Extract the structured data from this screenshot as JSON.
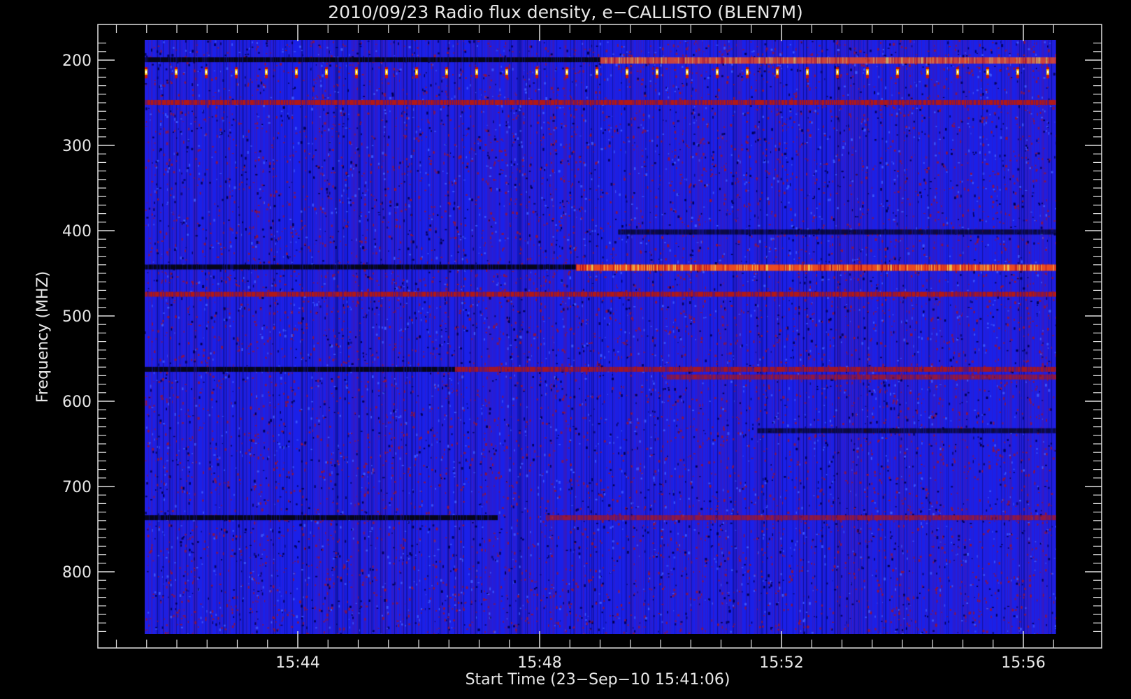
{
  "chart_data": {
    "type": "heatmap",
    "title": "2010/09/23  Radio flux density, e−CALLISTO (BLEN7M)",
    "xlabel": "Start Time (23−Sep−10 15:41:06)",
    "ylabel": "Frequency (MHZ)",
    "x_range_minutes": [
      0,
      15.9
    ],
    "x_range": [
      "15:41:06",
      "15:57:00"
    ],
    "y_range_mhz": [
      178,
      878
    ],
    "y_inverted": true,
    "x_ticks": [
      {
        "label": "15:44",
        "minutes": 2.9
      },
      {
        "label": "15:48",
        "minutes": 6.9
      },
      {
        "label": "15:52",
        "minutes": 10.9
      },
      {
        "label": "15:56",
        "minutes": 14.9
      }
    ],
    "y_ticks": [
      200,
      300,
      400,
      500,
      600,
      700,
      800
    ],
    "colormap": [
      "#000000",
      "#0000ff",
      "#7a1a8a",
      "#c01010",
      "#ff4000",
      "#ffc000",
      "#ffffff"
    ],
    "background_color": "#1a20e8",
    "bands": [
      {
        "freq_mhz": 200,
        "minute_start": 0.0,
        "minute_end": 7.9,
        "level": "low"
      },
      {
        "freq_mhz": 200,
        "minute_start": 7.9,
        "minute_end": 15.9,
        "level": "high"
      },
      {
        "freq_mhz": 214,
        "minute_start": 0.0,
        "minute_end": 15.9,
        "level": "periodic-bursts"
      },
      {
        "freq_mhz": 250,
        "minute_start": 0.0,
        "minute_end": 15.9,
        "level": "medium"
      },
      {
        "freq_mhz": 402,
        "minute_start": 8.2,
        "minute_end": 15.9,
        "level": "low"
      },
      {
        "freq_mhz": 443,
        "minute_start": 0.0,
        "minute_end": 7.5,
        "level": "low"
      },
      {
        "freq_mhz": 443,
        "minute_start": 7.5,
        "minute_end": 15.9,
        "level": "high"
      },
      {
        "freq_mhz": 475,
        "minute_start": 0.0,
        "minute_end": 15.9,
        "level": "medium"
      },
      {
        "freq_mhz": 563,
        "minute_start": 0.0,
        "minute_end": 5.5,
        "level": "low"
      },
      {
        "freq_mhz": 563,
        "minute_start": 5.5,
        "minute_end": 15.9,
        "level": "medium"
      },
      {
        "freq_mhz": 572,
        "minute_start": 9.0,
        "minute_end": 15.9,
        "level": "medium"
      },
      {
        "freq_mhz": 635,
        "minute_start": 10.5,
        "minute_end": 15.9,
        "level": "low"
      },
      {
        "freq_mhz": 737,
        "minute_start": 0.0,
        "minute_end": 6.2,
        "level": "low"
      },
      {
        "freq_mhz": 737,
        "minute_start": 7.0,
        "minute_end": 15.9,
        "level": "medium"
      }
    ],
    "grid": false,
    "legend": "none"
  }
}
